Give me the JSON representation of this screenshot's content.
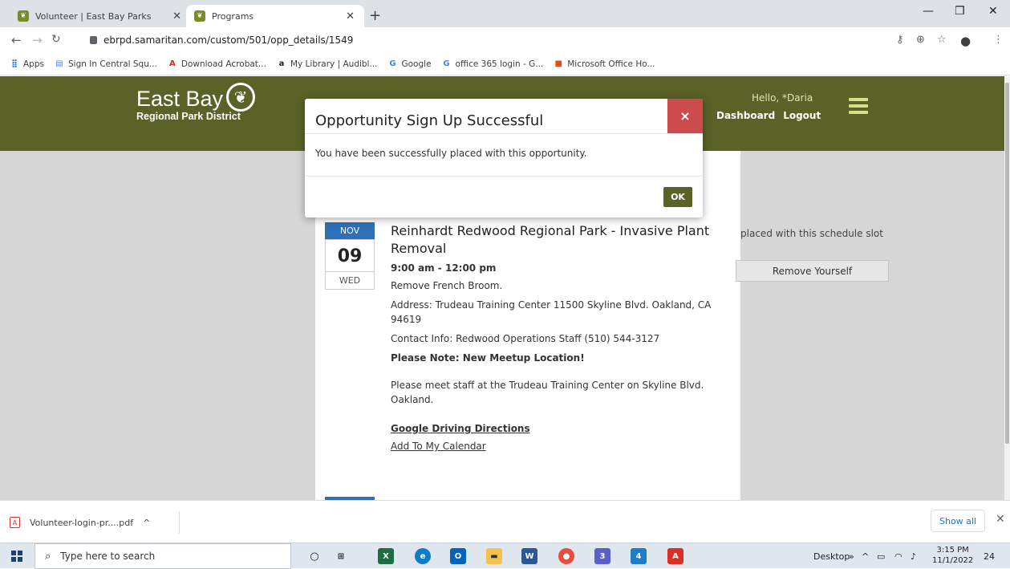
{
  "browser": {
    "tabs": [
      {
        "title": "Volunteer | East Bay Parks",
        "active": false
      },
      {
        "title": "Programs",
        "active": true
      }
    ],
    "url": "ebrpd.samaritan.com/custom/501/opp_details/1549",
    "bookmarks": [
      {
        "label": "Apps",
        "icon": "apps-grid-icon",
        "color": "#1a73e8"
      },
      {
        "label": "Sign In Central Squ...",
        "icon": "document-icon",
        "color": "#4285f4"
      },
      {
        "label": "Download Acrobat...",
        "icon": "acrobat-icon",
        "color": "#e2231a"
      },
      {
        "label": "My Library | Audibl...",
        "icon": "amazon-icon",
        "color": "#222222"
      },
      {
        "label": "Google",
        "icon": "google-icon",
        "color": "#4285f4"
      },
      {
        "label": "office 365 login - G...",
        "icon": "google-icon",
        "color": "#4285f4"
      },
      {
        "label": "Microsoft Office Ho...",
        "icon": "office-icon",
        "color": "#e64a19"
      }
    ]
  },
  "site": {
    "logo_line1": "East Bay",
    "logo_line2": "Regional Park District",
    "greeting": "Hello, *Daria",
    "nav_dashboard": "Dashboard",
    "nav_logout": "Logout",
    "brand_color": "#5a6228"
  },
  "modal": {
    "title": "Opportunity Sign Up Successful",
    "close_glyph": "×",
    "message": "You have been successfully placed with this opportunity.",
    "ok_label": "OK"
  },
  "event": {
    "month": "NOV",
    "day": "09",
    "weekday": "WED",
    "title": "Reinhardt Redwood Regional Park - Invasive Plant Removal",
    "time": "9:00 am - 12:00 pm",
    "description": "Remove French Broom.",
    "address": "Address: Trudeau Training Center 11500 Skyline Blvd. Oakland, CA 94619",
    "contact": "Contact Info: Redwood Operations Staff (510) 544-3127",
    "note_title": "Please Note: New Meetup Location!",
    "note_text": "Please meet staff at the Trudeau Training Center on Skyline Blvd. Oakland.",
    "directions_link": "Google Driving Directions",
    "calendar_link": "Add To My Calendar",
    "slot_status": "placed with this schedule slot",
    "remove_label": "Remove Yourself"
  },
  "downloads": {
    "file": "Volunteer-login-pr....pdf",
    "show_all": "Show all"
  },
  "taskbar": {
    "search_placeholder": "Type here to search",
    "desktop_label": "Desktop",
    "mail_badge": "4",
    "teams_badge": "3",
    "notification_count": "24",
    "time": "3:15 PM",
    "date": "11/1/2022"
  }
}
